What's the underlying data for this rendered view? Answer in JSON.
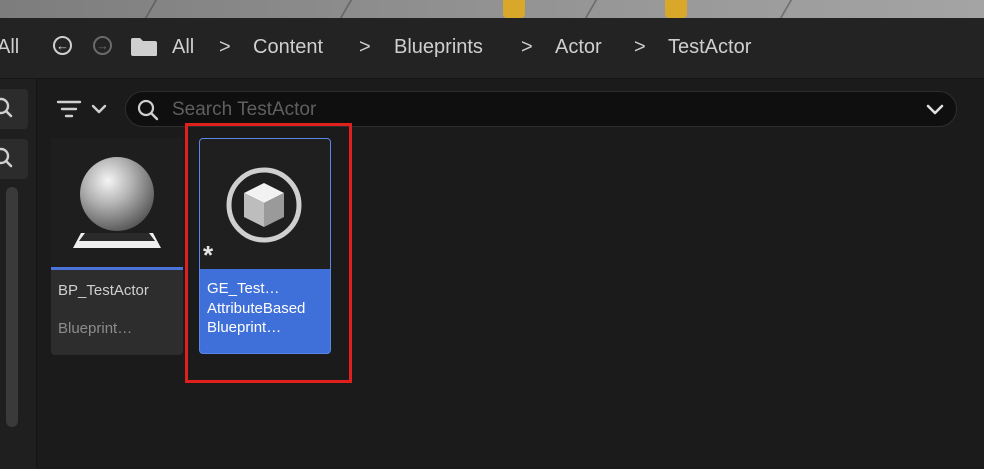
{
  "breadcrumb": {
    "all_left": "All",
    "items": [
      "All",
      "Content",
      "Blueprints",
      "Actor",
      "TestActor"
    ],
    "separator": ">"
  },
  "search": {
    "placeholder": "Search TestActor"
  },
  "assets": [
    {
      "name": "BP_TestActor",
      "type": "Blueprint…",
      "icon": "sphere-icon",
      "selected": false
    },
    {
      "name_line1": "GE_Test…",
      "name_line2": "AttributeBased",
      "type": "Blueprint…",
      "icon": "cube-icon",
      "selected": true,
      "modified_marker": "*"
    }
  ],
  "colors": {
    "selection_blue": "#3f6fd8",
    "highlight_red": "#e0201c",
    "viewport_yellow": "#d9a82b"
  }
}
